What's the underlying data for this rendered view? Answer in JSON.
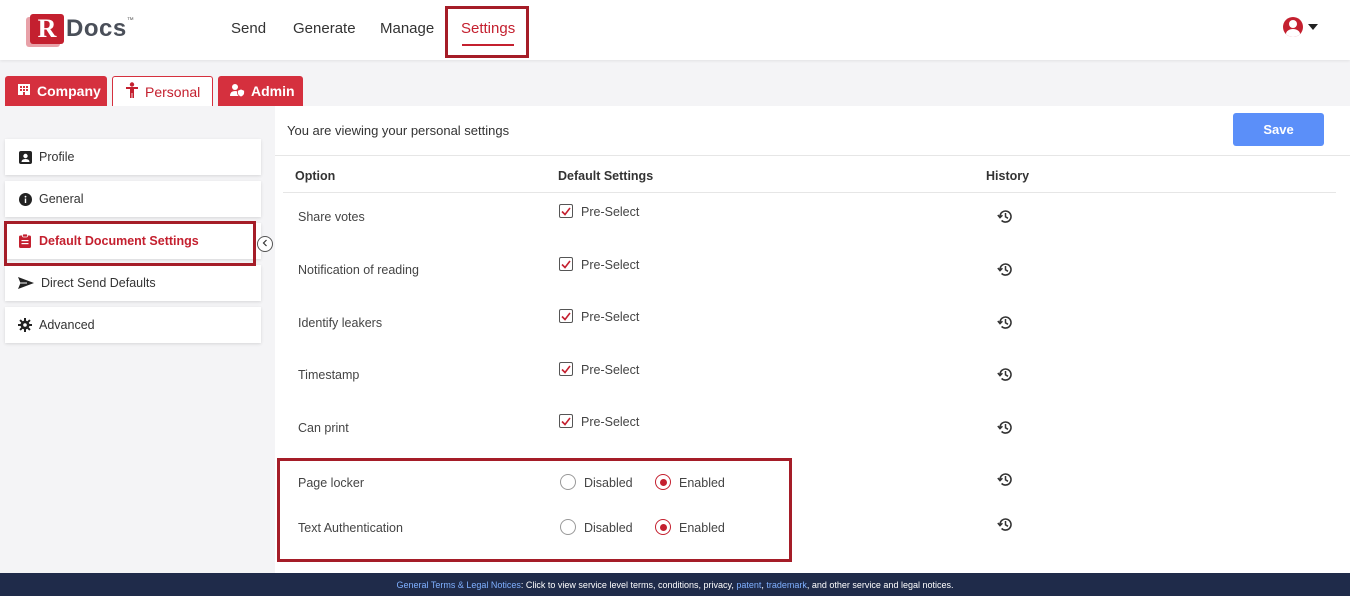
{
  "brand": {
    "logo_letter": "R",
    "logo_text": "Docs",
    "trademark": "™"
  },
  "nav": {
    "items": [
      "Send",
      "Generate",
      "Manage",
      "Settings"
    ]
  },
  "tabs": [
    "Company",
    "Personal",
    "Admin"
  ],
  "sidebar": {
    "items": [
      {
        "label": "Profile",
        "icon": "profile-card-icon"
      },
      {
        "label": "General",
        "icon": "info-icon"
      },
      {
        "label": "Default Document Settings",
        "icon": "clipboard-icon",
        "active": true
      },
      {
        "label": "Direct Send Defaults",
        "icon": "paper-plane-icon"
      },
      {
        "label": "Advanced",
        "icon": "gear-icon"
      }
    ]
  },
  "main": {
    "viewing_text": "You are viewing your personal settings",
    "save_label": "Save",
    "columns": [
      "Option",
      "Default Settings",
      "History"
    ],
    "rows": [
      {
        "label": "Share votes",
        "control": "checkbox",
        "checked": true,
        "text": "Pre-Select"
      },
      {
        "label": "Notification of reading",
        "control": "checkbox",
        "checked": true,
        "text": "Pre-Select"
      },
      {
        "label": "Identify leakers",
        "control": "checkbox",
        "checked": true,
        "text": "Pre-Select"
      },
      {
        "label": "Timestamp",
        "control": "checkbox",
        "checked": true,
        "text": "Pre-Select"
      },
      {
        "label": "Can print",
        "control": "checkbox",
        "checked": true,
        "text": "Pre-Select"
      },
      {
        "label": "Page locker",
        "control": "radio",
        "options": [
          "Disabled",
          "Enabled"
        ],
        "selected": "Enabled"
      },
      {
        "label": "Text Authentication",
        "control": "radio",
        "options": [
          "Disabled",
          "Enabled"
        ],
        "selected": "Enabled"
      }
    ]
  },
  "footer": {
    "link1": "General Terms & Legal Notices",
    "text1": ": Click to view service level terms, conditions, privacy, ",
    "link2": "patent",
    "text2": ", ",
    "link3": "trademark",
    "text3": ", and other service and legal notices."
  },
  "colors": {
    "accent": "#c4202f",
    "save": "#5b8ff9",
    "footer_bg": "#1f2b4a"
  }
}
